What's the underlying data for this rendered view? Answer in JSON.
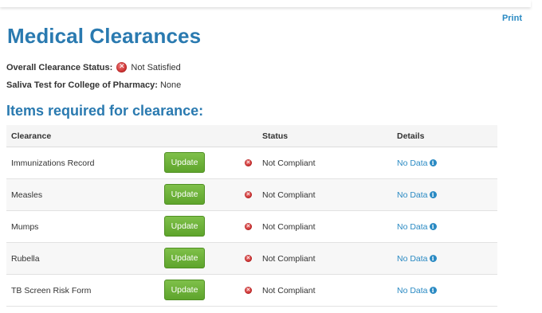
{
  "header": {
    "print_label": "Print",
    "title": "Medical Clearances"
  },
  "overall": {
    "label": "Overall Clearance Status:",
    "icon": "x-circle-icon",
    "value": "Not Satisfied"
  },
  "saliva": {
    "label": "Saliva Test for College of Pharmacy:",
    "value": "None"
  },
  "section": {
    "title": "Items required for clearance:"
  },
  "table": {
    "columns": {
      "clearance": "Clearance",
      "status": "Status",
      "details": "Details"
    },
    "rows": [
      {
        "name": "Immunizations Record",
        "button": "Update",
        "status": "Not Compliant",
        "details": "No Data"
      },
      {
        "name": "Measles",
        "button": "Update",
        "status": "Not Compliant",
        "details": "No Data"
      },
      {
        "name": "Mumps",
        "button": "Update",
        "status": "Not Compliant",
        "details": "No Data"
      },
      {
        "name": "Rubella",
        "button": "Update",
        "status": "Not Compliant",
        "details": "No Data"
      },
      {
        "name": "TB Screen Risk Form",
        "button": "Update",
        "status": "Not Compliant",
        "details": "No Data"
      }
    ]
  },
  "colors": {
    "title_blue": "#2a7ab0",
    "link_blue": "#2a8ac3",
    "button_green": "#6db33f",
    "error_red": "#cf3535"
  }
}
